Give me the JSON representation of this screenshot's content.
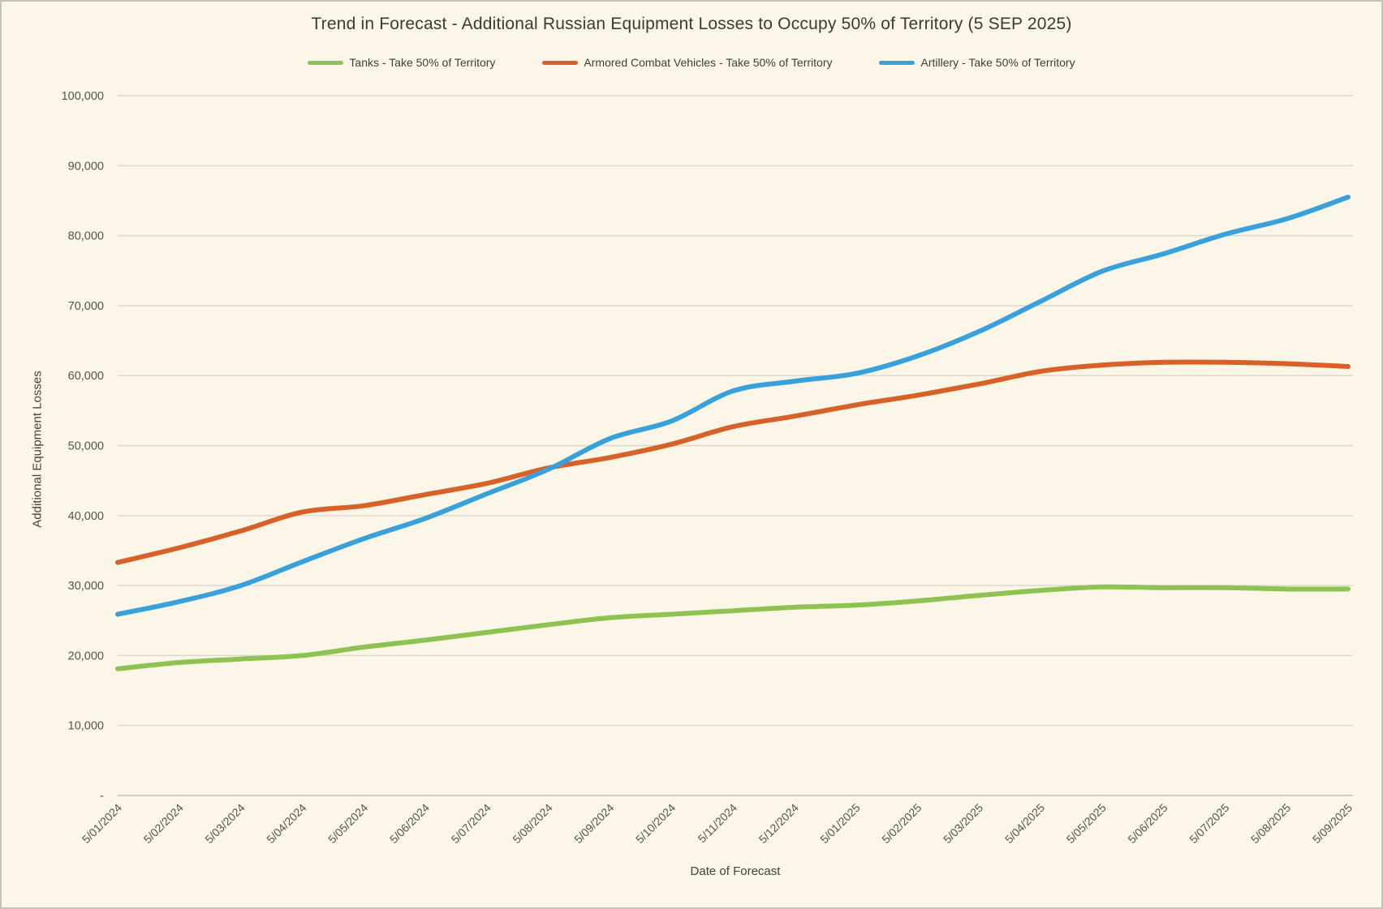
{
  "title": "Trend in Forecast - Additional Russian Equipment Losses to Occupy 50% of Territory (5 SEP 2025)",
  "legend": [
    {
      "label": "Tanks - Take 50% of Territory",
      "color": "#8EC351"
    },
    {
      "label": "Armored Combat Vehicles - Take 50% of Territory",
      "color": "#D86127"
    },
    {
      "label": "Artillery - Take 50% of Territory",
      "color": "#38A1DB"
    }
  ],
  "chart_data": {
    "type": "line",
    "title": "Trend in Forecast - Additional Russian Equipment Losses to Occupy 50% of Territory (5 SEP 2025)",
    "xlabel": "Date of Forecast",
    "ylabel": "Additional Equipment Losses",
    "ylim": [
      0,
      100000
    ],
    "ytick_step": 10000,
    "zero_tick_label": "-",
    "grid": true,
    "legend_position": "top-center",
    "categories": [
      "5/01/2024",
      "5/02/2024",
      "5/03/2024",
      "5/04/2024",
      "5/05/2024",
      "5/06/2024",
      "5/07/2024",
      "5/08/2024",
      "5/09/2024",
      "5/10/2024",
      "5/11/2024",
      "5/12/2024",
      "5/01/2025",
      "5/02/2025",
      "5/03/2025",
      "5/04/2025",
      "5/05/2025",
      "5/06/2025",
      "5/07/2025",
      "5/08/2025",
      "5/09/2025"
    ],
    "series": [
      {
        "name": "Tanks - Take 50% of Territory",
        "color": "#8EC351",
        "values": [
          18100,
          19000,
          19500,
          20000,
          21200,
          22200,
          23300,
          24400,
          25400,
          25900,
          26400,
          26900,
          27200,
          27800,
          28600,
          29300,
          29800,
          29700,
          29700,
          29500,
          29500
        ]
      },
      {
        "name": "Armored Combat Vehicles - Take 50% of Territory",
        "color": "#D86127",
        "values": [
          33300,
          35400,
          37800,
          40500,
          41400,
          43000,
          44600,
          46800,
          48300,
          50200,
          52700,
          54200,
          55800,
          57200,
          58800,
          60600,
          61500,
          61900,
          61900,
          61700,
          61300
        ]
      },
      {
        "name": "Artillery - Take 50% of Territory",
        "color": "#38A1DB",
        "values": [
          25900,
          27700,
          30000,
          33400,
          36700,
          39600,
          43100,
          46600,
          51000,
          53500,
          57800,
          59200,
          60300,
          62800,
          66300,
          70600,
          74900,
          77400,
          80200,
          82400,
          85500
        ]
      }
    ]
  },
  "colors": {
    "background": "#FBF6E7",
    "frame_border": "#C6C3B9",
    "gridline": "#DAD7CD",
    "axis_line": "#C1BEB4",
    "tick_text": "#57544E",
    "title_text": "#3C3A34"
  }
}
